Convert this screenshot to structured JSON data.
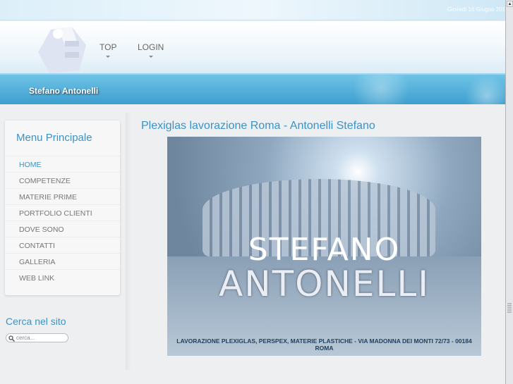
{
  "topbar": {
    "date": "Giovedì 16 Giugno 201"
  },
  "nav": [
    {
      "label": "TOP"
    },
    {
      "label": "LOGIN"
    }
  ],
  "banner": {
    "site_name": "Stefano Antonelli"
  },
  "sidebar": {
    "title": "Menu Principale",
    "items": [
      {
        "label": "HOME"
      },
      {
        "label": "COMPETENZE"
      },
      {
        "label": "MATERIE PRIME"
      },
      {
        "label": "PORTFOLIO CLIENTI"
      },
      {
        "label": "DOVE SONO"
      },
      {
        "label": "CONTATTI"
      },
      {
        "label": "GALLERIA"
      },
      {
        "label": "WEB LINK"
      }
    ]
  },
  "search": {
    "title": "Cerca nel sito",
    "placeholder": "cerca..."
  },
  "main": {
    "title": "Plexiglas lavorazione Roma - Antonelli Stefano",
    "hero": {
      "line1": "STEFANO",
      "line2": "ANTONELLI",
      "caption": "LAVORAZIONE PLEXIGLAS, PERSPEX, MATERIE PLASTICHE - VIA MADONNA DEI MONTI 72/73 - 00184  ROMA"
    }
  },
  "colors": {
    "accent": "#3a93c6",
    "banner": "#3d9fcf"
  }
}
